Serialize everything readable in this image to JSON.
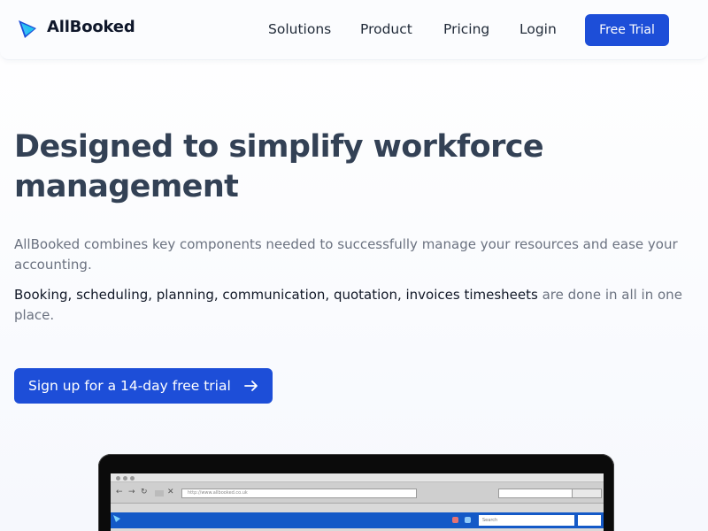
{
  "brand": {
    "name": "AllBooked",
    "logo_icon": "play-triangle-icon",
    "logo_colors": [
      "#1d4ed8",
      "#22c3ee"
    ]
  },
  "nav": {
    "items": [
      {
        "label": "Solutions"
      },
      {
        "label": "Product"
      },
      {
        "label": "Pricing"
      },
      {
        "label": "Login"
      }
    ],
    "cta_label": "Free Trial"
  },
  "hero": {
    "title": "Designed to simplify workforce management",
    "description": "AllBooked combines key components needed to successfully manage your resources and ease your accounting.",
    "description2_strong": "Booking, scheduling, planning, communication, quotation, invoices timesheets",
    "description2_rest": " are done in all in one place.",
    "cta_label": "Sign up for a 14-day free trial",
    "cta_icon": "arrow-right-icon"
  },
  "mockup": {
    "url_text": "http://www.allbooked.co.uk",
    "search_placeholder": "Search"
  },
  "colors": {
    "accent": "#1d4ed8",
    "heading": "#334155",
    "body_text": "#6b7280"
  }
}
